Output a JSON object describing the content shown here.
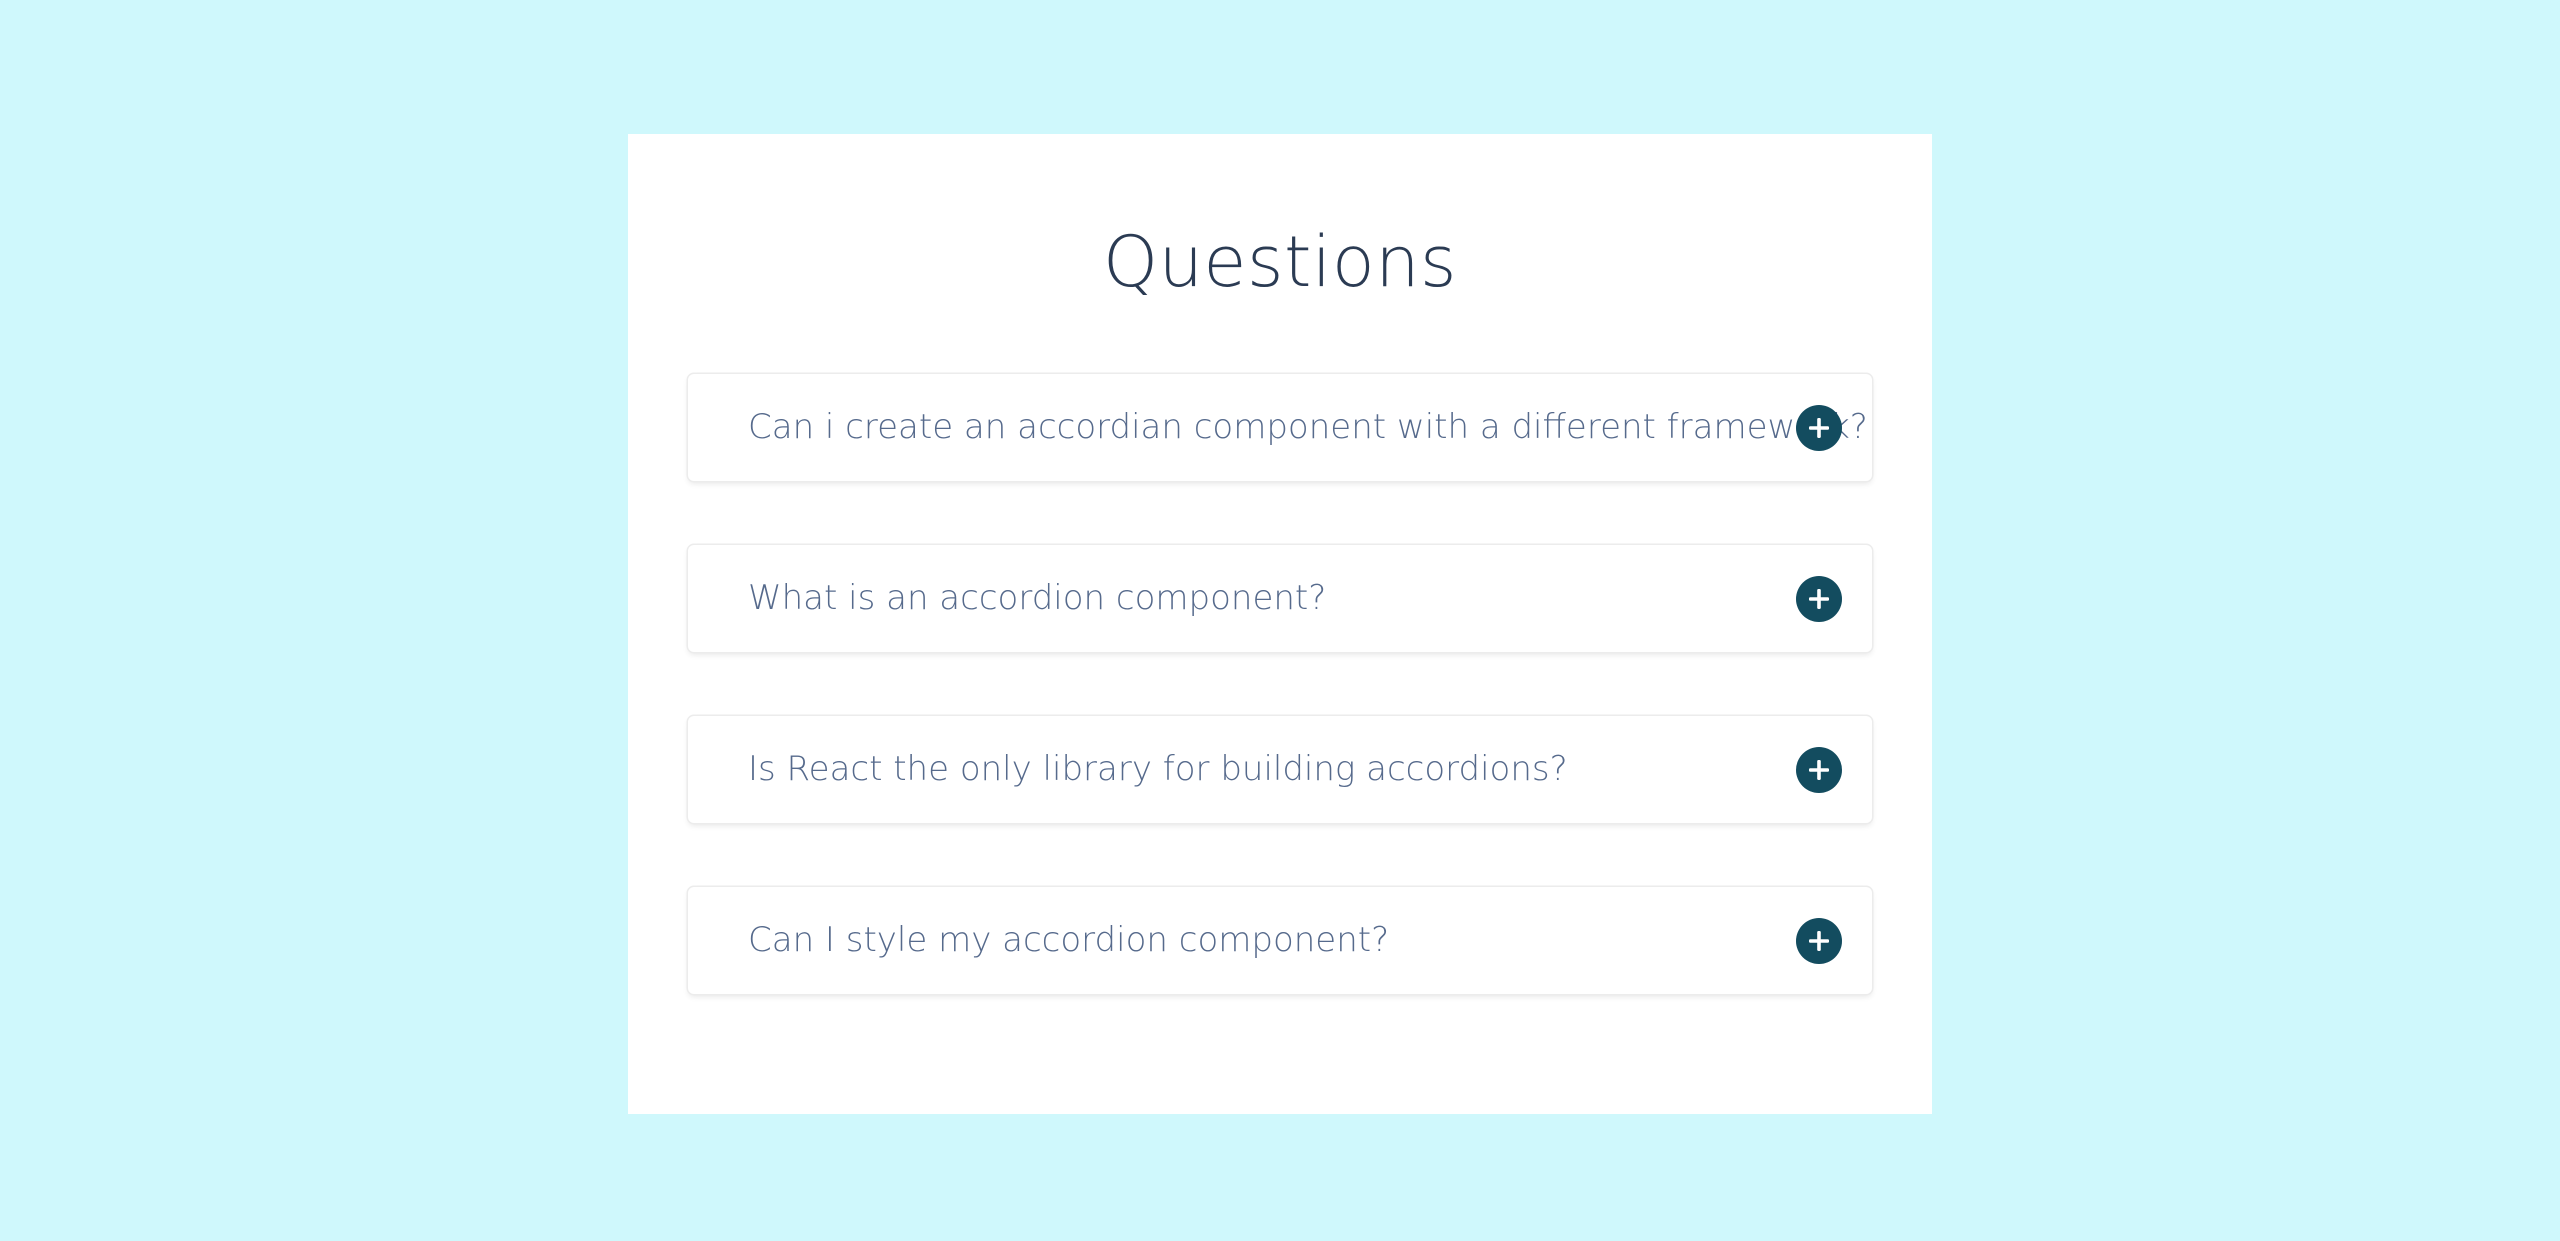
{
  "page": {
    "title": "Questions"
  },
  "colors": {
    "background": "#cff8fc",
    "card": "#ffffff",
    "title": "#2b3b53",
    "question_text": "#566a8c",
    "toggle_button": "#134c5f"
  },
  "faq": {
    "items": [
      {
        "question": "Can i create an accordian component with a different framework?",
        "icon": "plus-icon",
        "expanded": false
      },
      {
        "question": "What is an accordion component?",
        "icon": "plus-icon",
        "expanded": false
      },
      {
        "question": "Is React the only library for building accordions?",
        "icon": "plus-icon",
        "expanded": false
      },
      {
        "question": "Can I style my accordion component?",
        "icon": "plus-icon",
        "expanded": false
      }
    ]
  }
}
